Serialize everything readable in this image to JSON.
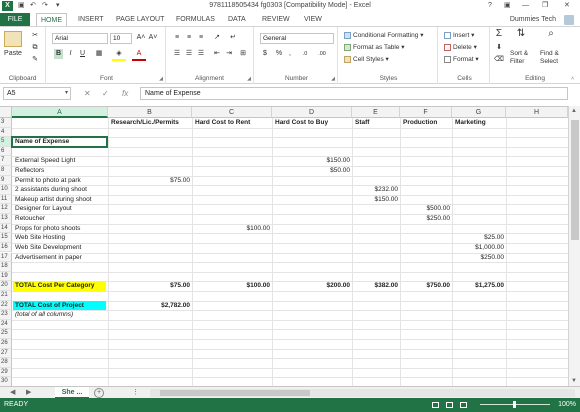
{
  "window": {
    "app_icon": "X",
    "title": "9781118505434 fg0303  [Compatibility Mode] - Excel",
    "help": "?",
    "min": "—",
    "max": "❐",
    "close": "✕"
  },
  "qat": {
    "save": "▣",
    "undo": "↶",
    "redo": "↷",
    "customize": "▾"
  },
  "tabs": [
    "FILE",
    "HOME",
    "INSERT",
    "PAGE LAYOUT",
    "FORMULAS",
    "DATA",
    "REVIEW",
    "VIEW"
  ],
  "user": {
    "name": "Dummies Tech"
  },
  "ribbon": {
    "clipboard": {
      "label": "Clipboard",
      "paste": "Paste"
    },
    "font": {
      "label": "Font",
      "family": "Arial",
      "size": "10",
      "grow": "A˄",
      "shrink": "A˅",
      "bold": "B",
      "italic": "I",
      "underline": "U"
    },
    "alignment": {
      "label": "Alignment"
    },
    "number": {
      "label": "Number",
      "format": "General",
      "currency": "$",
      "percent": "%",
      "comma": ",",
      "inc": ".0",
      "dec": ".00"
    },
    "styles": {
      "label": "Styles",
      "conditional": "Conditional Formatting",
      "format_table": "Format as Table",
      "cell_styles": "Cell Styles"
    },
    "cells": {
      "label": "Cells",
      "insert": "Insert",
      "delete": "Delete",
      "format": "Format"
    },
    "editing": {
      "label": "Editing",
      "sum": "Σ",
      "sort": "Sort &",
      "filter": "Filter",
      "find": "Find &",
      "select": "Select"
    }
  },
  "formula_bar": {
    "name_box": "A5",
    "cancel": "✕",
    "enter": "✓",
    "fx": "fx",
    "content": "Name of Expense"
  },
  "columns": [
    "A",
    "B",
    "C",
    "D",
    "E",
    "F",
    "G",
    "H"
  ],
  "rows": [
    "3",
    "4",
    "5",
    "6",
    "7",
    "8",
    "9",
    "10",
    "11",
    "12",
    "13",
    "14",
    "15",
    "16",
    "17",
    "18",
    "19",
    "20",
    "21",
    "22",
    "23",
    "24",
    "25",
    "26",
    "27",
    "28",
    "29",
    "30"
  ],
  "headers": {
    "b": "Research/Lic./Permits",
    "c": "Hard Cost to Rent",
    "d": "Hard Cost to Buy",
    "e": "Staff",
    "f": "Production",
    "g": "Marketing"
  },
  "a5": "Name of Expense",
  "items": [
    {
      "row": 7,
      "label": "External Speed Light",
      "d": "$150.00"
    },
    {
      "row": 8,
      "label": "Reflectors",
      "d": "$50.00"
    },
    {
      "row": 9,
      "label": "Permit to photo at park",
      "b": "$75.00"
    },
    {
      "row": 10,
      "label": "2 assistants during shoot",
      "e": "$232.00"
    },
    {
      "row": 11,
      "label": "Makeup artist during shoot",
      "e": "$150.00"
    },
    {
      "row": 12,
      "label": "Designer for Layout",
      "f": "$500.00"
    },
    {
      "row": 13,
      "label": "Retoucher",
      "f": "$250.00"
    },
    {
      "row": 14,
      "label": "Props for photo shoots",
      "c": "$100.00"
    },
    {
      "row": 15,
      "label": "Web Site Hosting",
      "g": "$25.00"
    },
    {
      "row": 16,
      "label": "Web Site Development",
      "g": "$1,000.00"
    },
    {
      "row": 17,
      "label": "Advertisement in paper",
      "g": "$250.00"
    }
  ],
  "totals": {
    "label": "TOTAL Cost Per Category",
    "b": "$75.00",
    "c": "$100.00",
    "d": "$200.00",
    "e": "$382.00",
    "f": "$750.00",
    "g": "$1,275.00"
  },
  "project_total": {
    "label": "TOTAL Cost of Project",
    "value": "$2,782.00",
    "note": "(total of all columns)"
  },
  "sheet": {
    "tab": "She ...",
    "add": "+",
    "prev": "◀",
    "next": "▶",
    "more": "..."
  },
  "status": {
    "ready": "READY",
    "zoom": "100%"
  },
  "colors": {
    "accent": "#217346",
    "yellow": "#ffff00",
    "cyan": "#00ffff"
  }
}
